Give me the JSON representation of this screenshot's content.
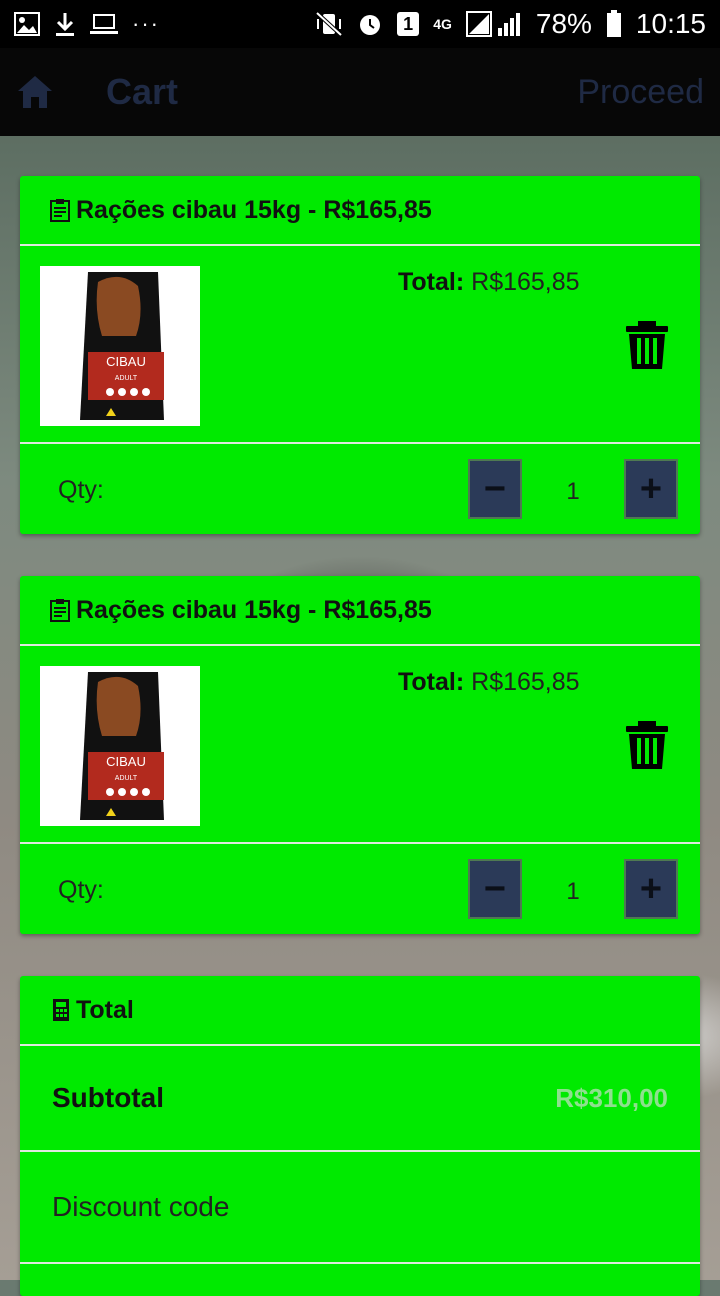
{
  "status_bar": {
    "battery": "78%",
    "time": "10:15",
    "network": "4G",
    "notification_count": "1",
    "more": "···"
  },
  "app_bar": {
    "title": "Cart",
    "proceed_label": "Proceed"
  },
  "cart_items": [
    {
      "title": "Rações cibau 15kg - R$165,85",
      "total_label": "Total:",
      "total_value": "R$165,85",
      "qty_label": "Qty:",
      "quantity": "1",
      "minus_label": "−",
      "plus_label": "+",
      "image_text": "CIBAU",
      "image_subtext": "ADULT"
    },
    {
      "title": "Rações cibau 15kg - R$165,85",
      "total_label": "Total:",
      "total_value": "R$165,85",
      "qty_label": "Qty:",
      "quantity": "1",
      "minus_label": "−",
      "plus_label": "+",
      "image_text": "CIBAU",
      "image_subtext": "ADULT"
    }
  ],
  "summary": {
    "title": "Total",
    "subtotal_label": "Subtotal",
    "subtotal_value": "R$310,00",
    "discount_label": "Discount code"
  },
  "colors": {
    "card_bg": "#00ea00",
    "app_bar_bg": "#070707",
    "accent_dark": "#1f2a44",
    "button_bg": "#2b3a58"
  }
}
